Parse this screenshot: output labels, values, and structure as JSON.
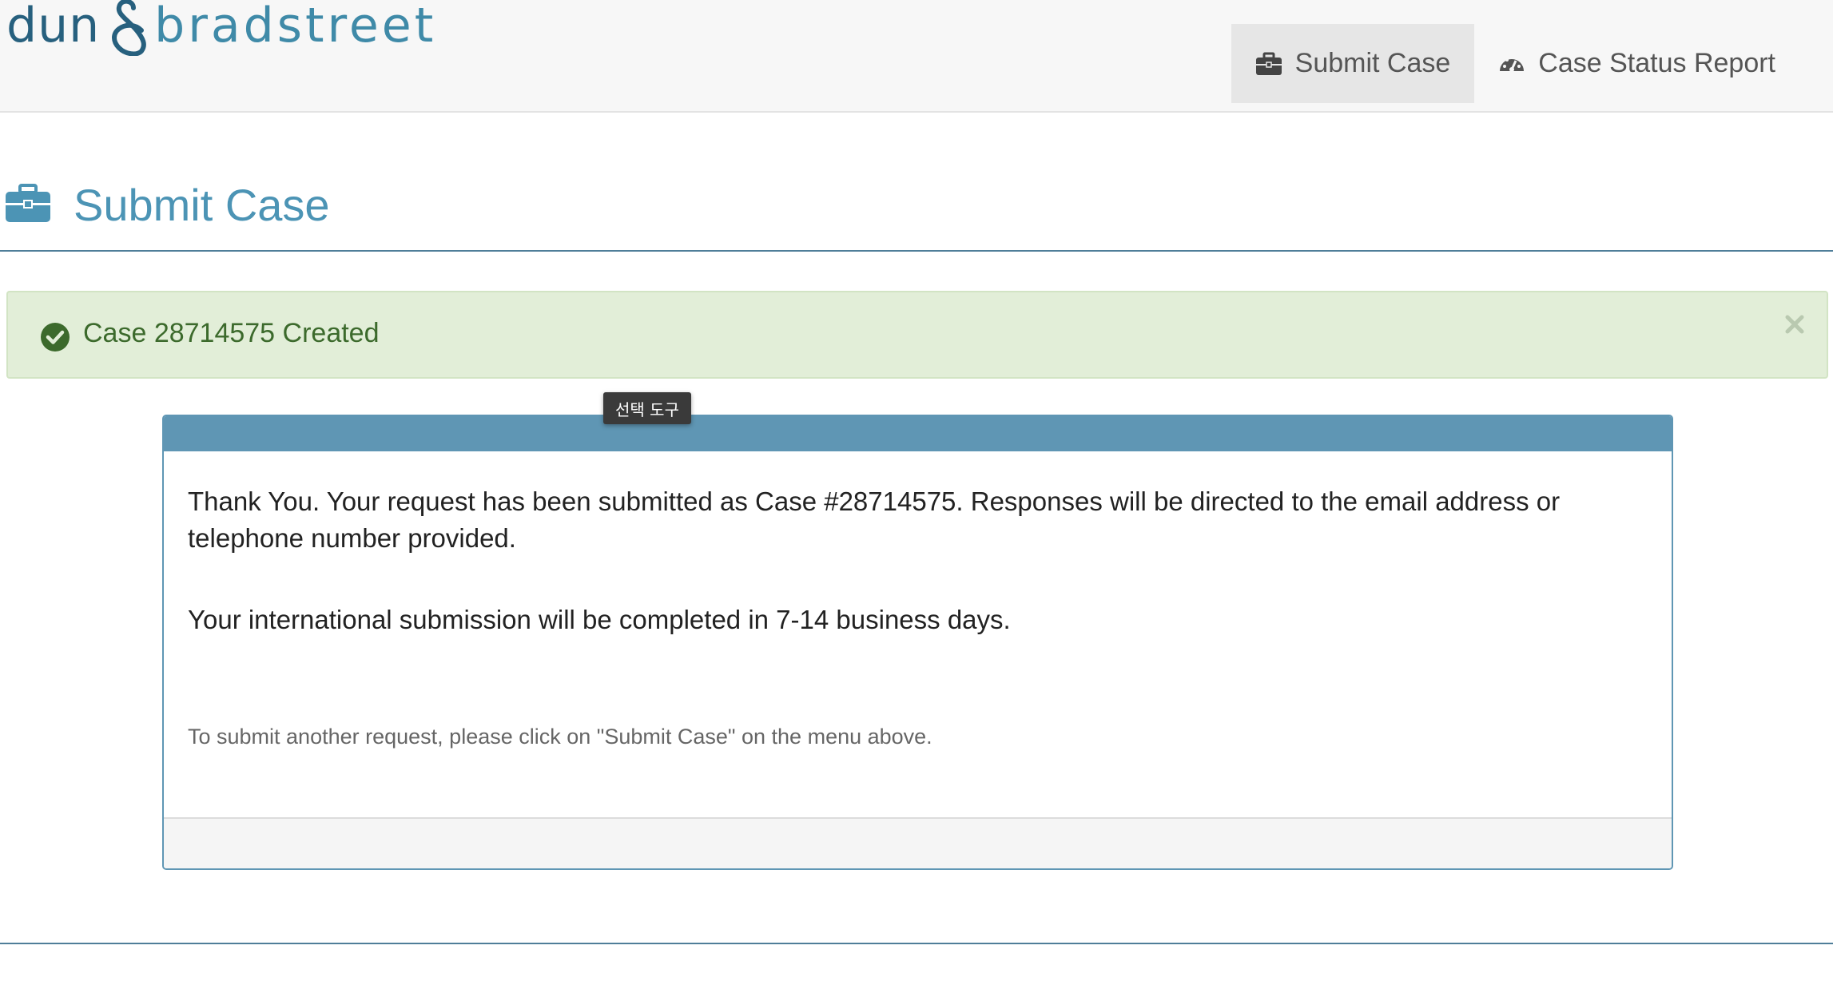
{
  "logo": {
    "part1": "dun",
    "part2": "bradstreet",
    "amp_icon": "ampersand-logo-mark"
  },
  "nav": {
    "items": [
      {
        "label": "Submit Case",
        "icon": "briefcase-icon",
        "active": true
      },
      {
        "label": "Case Status Report",
        "icon": "dashboard-gauge-icon",
        "active": false
      }
    ]
  },
  "page": {
    "title": "Submit Case",
    "icon": "briefcase-icon"
  },
  "alert": {
    "text": "Case 28714575 Created",
    "icon": "check-circle-icon",
    "close_icon": "close-icon"
  },
  "tooltip": {
    "text": "선택 도구"
  },
  "panel": {
    "message1": "Thank You.  Your request has been submitted as Case #28714575. Responses will be directed to the email address or telephone number provided.",
    "message2": "Your international submission will be completed in 7-14 business days.",
    "message3": "To submit another request, please click on \"Submit Case\" on the menu above."
  },
  "colors": {
    "brand_dark": "#27607e",
    "brand_light": "#3f8aa8",
    "title_blue": "#4c94b5",
    "panel_header": "#5f96b4",
    "success_bg": "#e2eed8",
    "success_text": "#3c6a2c"
  }
}
